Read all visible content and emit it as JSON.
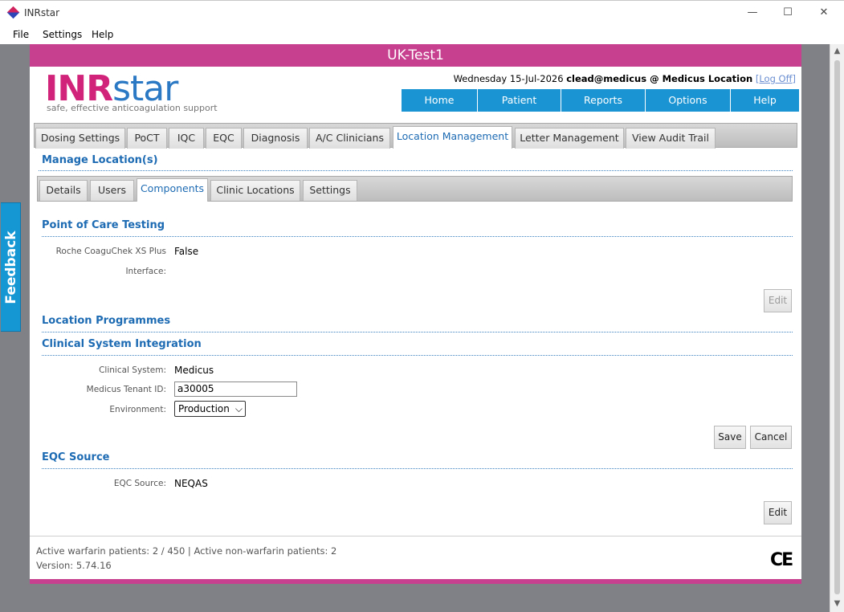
{
  "window": {
    "title": "INRstar",
    "minimize": "—",
    "maximize": "☐",
    "close": "✕"
  },
  "menu": [
    "File",
    "Settings",
    "Help"
  ],
  "feedback": "Feedback",
  "banner": "UK-Test1",
  "logo": {
    "inr": "INR",
    "star": "star",
    "tagline": "safe, effective anticoagulation support"
  },
  "user": {
    "date": "Wednesday 15-Jul-2026",
    "account": "clead@medicus @ Medicus Location",
    "logoff": "[Log Off]"
  },
  "nav": [
    "Home",
    "Patient",
    "Reports",
    "Options",
    "Help"
  ],
  "tabs": [
    "Dosing Settings",
    "PoCT",
    "IQC",
    "EQC",
    "Diagnosis",
    "A/C Clinicians",
    "Location Management",
    "Letter Management",
    "View Audit Trail"
  ],
  "manage_title": "Manage Location(s)",
  "subtabs": [
    "Details",
    "Users",
    "Components",
    "Clinic Locations",
    "Settings"
  ],
  "poct": {
    "title": "Point of Care Testing",
    "roche_label": "Roche CoaguChek XS Plus",
    "roche_value": "False",
    "interface_label": "Interface:",
    "edit": "Edit"
  },
  "programmes_title": "Location Programmes",
  "csi": {
    "title": "Clinical System Integration",
    "system_label": "Clinical System:",
    "system_value": "Medicus",
    "tenant_label": "Medicus Tenant ID:",
    "tenant_value": "a30005",
    "env_label": "Environment:",
    "env_value": "Production",
    "save": "Save",
    "cancel": "Cancel"
  },
  "eqc": {
    "title": "EQC Source",
    "label": "EQC Source:",
    "value": "NEQAS",
    "edit": "Edit"
  },
  "footer": {
    "patients": "Active warfarin patients: 2 / 450 | Active non-warfarin patients: 2",
    "version": "Version: 5.74.16",
    "ce": "CE"
  },
  "colors": {
    "brand_pink": "#c7408f",
    "nav_blue": "#1a94d2",
    "heading_blue": "#1d6bb3"
  }
}
